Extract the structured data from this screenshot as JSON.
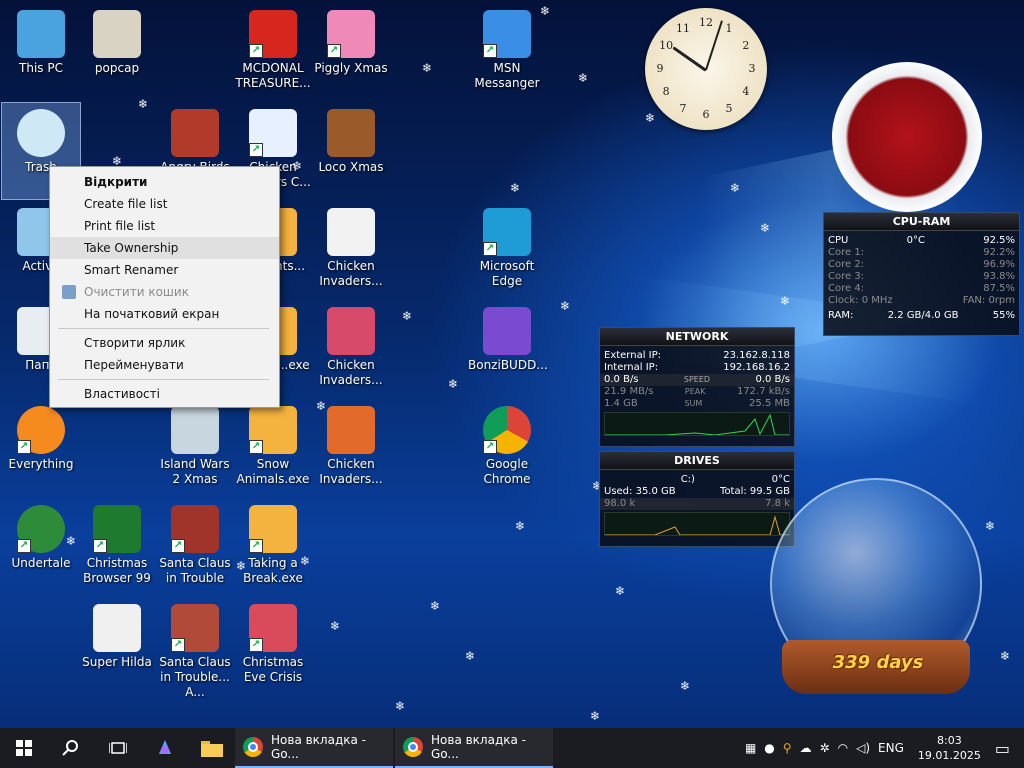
{
  "desktop": {
    "icons": [
      {
        "id": "this-pc",
        "label": "This PC",
        "shortcut": false
      },
      {
        "id": "trash",
        "label": "Trash",
        "shortcut": false
      },
      {
        "id": "activate",
        "label": "Activa",
        "shortcut": false
      },
      {
        "id": "folder",
        "label": "Папк",
        "shortcut": false
      },
      {
        "id": "everything",
        "label": "Everything",
        "shortcut": true
      },
      {
        "id": "undertale",
        "label": "Undertale",
        "shortcut": true
      },
      {
        "id": "popcap",
        "label": "popcap",
        "shortcut": false
      },
      {
        "id": "angry-birds",
        "label": "Angry Birds",
        "shortcut": false
      },
      {
        "id": "island-wars",
        "label": "Island Wars 2 Xmas",
        "shortcut": false
      },
      {
        "id": "christmas-browser",
        "label": "Christmas Browser 99",
        "shortcut": true
      },
      {
        "id": "santa-trouble",
        "label": "Santa Claus in Trouble",
        "shortcut": true
      },
      {
        "id": "super-hilda",
        "label": "Super Hilda",
        "shortcut": false
      },
      {
        "id": "santa-trouble-2",
        "label": "Santa Claus in Trouble... A...",
        "shortcut": true
      },
      {
        "id": "mcdonald",
        "label": "MCDONAL TREASURE...",
        "shortcut": true
      },
      {
        "id": "chicken-snow",
        "label": "Chicken Invaders C...",
        "shortcut": true
      },
      {
        "id": "snow-presents",
        "label": "...e ...nts...",
        "shortcut": true
      },
      {
        "id": "christmas-exe",
        "label": "...mas ...exe",
        "shortcut": true
      },
      {
        "id": "snow-animals",
        "label": "Snow Animals.exe",
        "shortcut": true
      },
      {
        "id": "taking-break",
        "label": "Taking a Break.exe",
        "shortcut": true
      },
      {
        "id": "christmas-eve",
        "label": "Christmas Eve Crisis",
        "shortcut": true
      },
      {
        "id": "piggly",
        "label": "Piggly Xmas",
        "shortcut": true
      },
      {
        "id": "loco",
        "label": "Loco Xmas",
        "shortcut": false
      },
      {
        "id": "chicken-inv-1",
        "label": "Chicken Invaders...",
        "shortcut": false
      },
      {
        "id": "chicken-inv-2",
        "label": "Chicken Invaders...",
        "shortcut": false
      },
      {
        "id": "chicken-inv-3",
        "label": "Chicken Invaders...",
        "shortcut": false
      },
      {
        "id": "msn",
        "label": "MSN Messanger",
        "shortcut": true
      },
      {
        "id": "edge",
        "label": "Microsoft Edge",
        "shortcut": true
      },
      {
        "id": "bonzi",
        "label": "BonziBUDD...",
        "shortcut": false
      },
      {
        "id": "chrome",
        "label": "Google Chrome",
        "shortcut": true
      }
    ]
  },
  "context_menu": {
    "items": [
      {
        "label": "Відкрити",
        "bold": true,
        "disabled": false,
        "hover": false,
        "icon": false
      },
      {
        "label": "Create file list",
        "bold": false,
        "disabled": false,
        "hover": false,
        "icon": false
      },
      {
        "label": "Print file list",
        "bold": false,
        "disabled": false,
        "hover": false,
        "icon": false
      },
      {
        "label": "Take Ownership",
        "bold": false,
        "disabled": false,
        "hover": true,
        "icon": false
      },
      {
        "label": "Smart Renamer",
        "bold": false,
        "disabled": false,
        "hover": false,
        "icon": false
      },
      {
        "label": "Очистити кошик",
        "bold": false,
        "disabled": true,
        "hover": false,
        "icon": true
      },
      {
        "label": "На початковий екран",
        "bold": false,
        "disabled": false,
        "hover": false,
        "icon": false
      },
      {
        "sep": true
      },
      {
        "label": "Створити ярлик",
        "bold": false,
        "disabled": false,
        "hover": false,
        "icon": false
      },
      {
        "label": "Перейменувати",
        "bold": false,
        "disabled": false,
        "hover": false,
        "icon": false
      },
      {
        "sep": true
      },
      {
        "label": "Властивості",
        "bold": false,
        "disabled": false,
        "hover": false,
        "icon": false
      }
    ]
  },
  "cpu_ram": {
    "title": "CPU-RAM",
    "cpu_label": "CPU",
    "cpu_temp": "0°C",
    "cpu_value": "92.5%",
    "cores": [
      {
        "label": "Core 1:",
        "value": "92.2%"
      },
      {
        "label": "Core 2:",
        "value": "96.9%"
      },
      {
        "label": "Core 3:",
        "value": "93.8%"
      },
      {
        "label": "Core 4:",
        "value": "87.5%"
      }
    ],
    "clock": "Clock: 0 MHz",
    "fan": "FAN: 0rpm",
    "ram_label": "RAM:",
    "ram_value": "2.2 GB/4.0 GB",
    "ram_percent": "55%"
  },
  "network": {
    "title": "NETWORK",
    "external_ip_label": "External IP:",
    "external_ip": "23.162.8.118",
    "internal_ip_label": "Internal IP:",
    "internal_ip": "192.168.16.2",
    "down_speed": "0.0 B/s",
    "speed_label": "SPEED",
    "up_speed": "0.0 B/s",
    "down_peak": "21.9 MB/s",
    "peak_label": "PEAK",
    "up_peak": "172.7 kB/s",
    "down_sum": "1.4 GB",
    "sum_label": "SUM",
    "up_sum": "25.5 MB"
  },
  "drives": {
    "title": "DRIVES",
    "temp": "0°C",
    "drive_letter": "C:)",
    "used": "Used: 35.0 GB",
    "total": "Total: 99.5 GB",
    "read": "98.0 k",
    "write": "7.8 k"
  },
  "countdown": {
    "text": "339 days"
  },
  "taskbar": {
    "apps": [
      {
        "label": "Нова вкладка - Go..."
      },
      {
        "label": "Нова вкладка - Go..."
      }
    ],
    "lang": "ENG",
    "time": "8:03",
    "date": "19.01.2025"
  }
}
